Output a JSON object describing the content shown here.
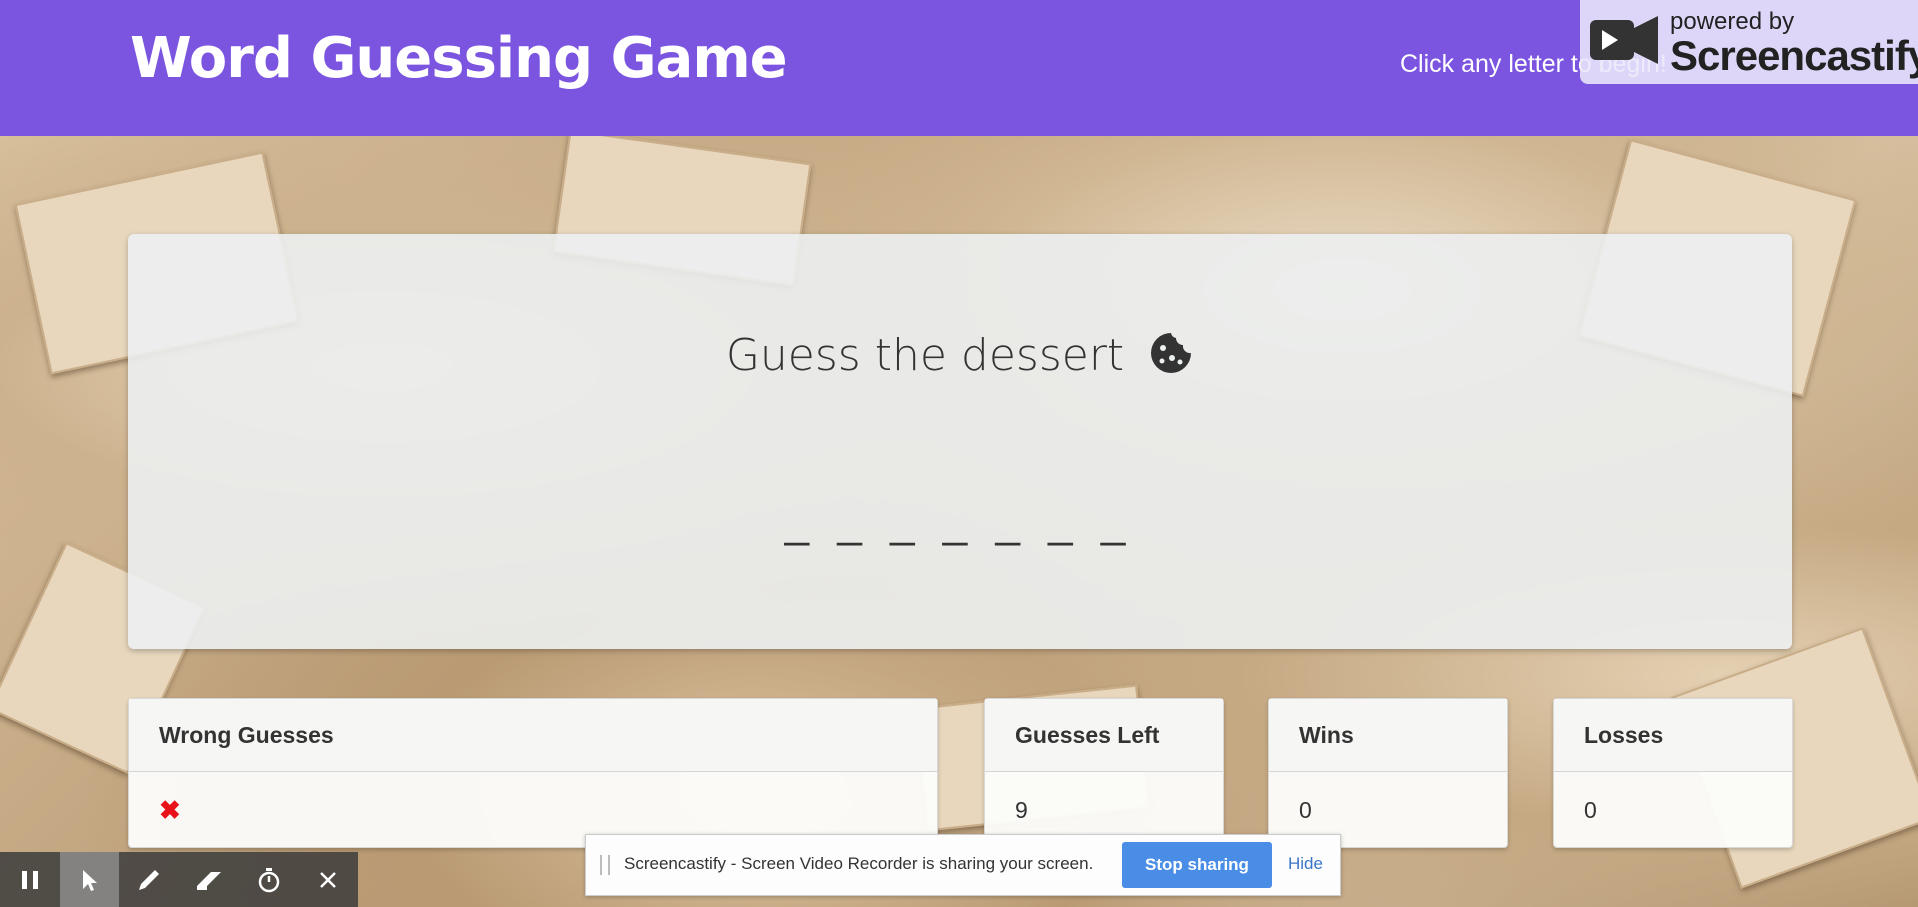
{
  "header": {
    "title": "Word Guessing Game",
    "hint": "Click any letter to begin!"
  },
  "brand": {
    "small": "powered by",
    "name": "Screencastify"
  },
  "game": {
    "prompt": "Guess the dessert",
    "prompt_icon": "cookie-icon",
    "blanks": "_ _ _ _ _ _ _"
  },
  "cards": {
    "wrong": {
      "label": "Wrong Guesses",
      "value": "✖"
    },
    "guesses_left": {
      "label": "Guesses Left",
      "value": "9"
    },
    "wins": {
      "label": "Wins",
      "value": "0"
    },
    "losses": {
      "label": "Losses",
      "value": "0"
    }
  },
  "toolbar": {
    "icons": [
      "pause-icon",
      "cursor-icon",
      "pen-icon",
      "eraser-icon",
      "timer-icon",
      "close-icon"
    ]
  },
  "share": {
    "message": "Screencastify - Screen Video Recorder is sharing your screen.",
    "stop_label": "Stop sharing",
    "hide_label": "Hide"
  },
  "colors": {
    "header": "#7b55e0",
    "stop_button": "#4a8de6",
    "wrong_mark": "#e8121a"
  }
}
